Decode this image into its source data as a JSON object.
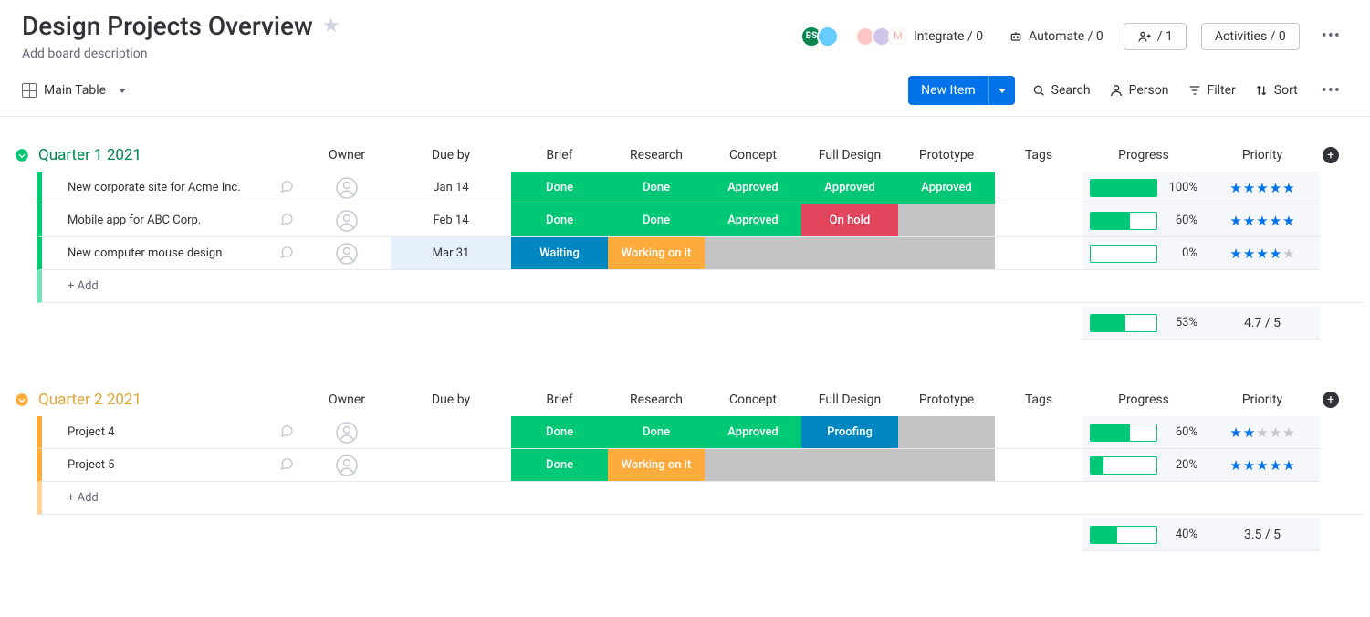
{
  "header": {
    "title": "Design Projects Overview",
    "description_placeholder": "Add board description",
    "avatars": [
      "BS",
      ""
    ],
    "integrate_label": "Integrate / 0",
    "automate_label": "Automate / 0",
    "invite_label": "/ 1",
    "activities_label": "Activities / 0"
  },
  "toolbar": {
    "view_label": "Main Table",
    "new_item_label": "New Item",
    "search_label": "Search",
    "person_label": "Person",
    "filter_label": "Filter",
    "sort_label": "Sort"
  },
  "columns": {
    "owner": "Owner",
    "due": "Due by",
    "brief": "Brief",
    "research": "Research",
    "concept": "Concept",
    "full_design": "Full Design",
    "prototype": "Prototype",
    "tags": "Tags",
    "progress": "Progress",
    "priority": "Priority"
  },
  "status_colors": {
    "Done": "#00c875",
    "Approved": "#00c875",
    "Waiting": "#0086c0",
    "Proofing": "#0086c0",
    "Working on it": "#fdab3d",
    "On hold": "#e2445c",
    "": "#c4c4c4"
  },
  "add_row_label": "+ Add",
  "groups": [
    {
      "name": "Quarter 1 2021",
      "color": "#00c875",
      "text_color": "#00854d",
      "summary": {
        "progress": 53,
        "priority": "4.7 / 5"
      },
      "items": [
        {
          "name": "New corporate site for Acme Inc.",
          "due": "Jan 14",
          "due_hl": false,
          "status": [
            "Done",
            "Done",
            "Approved",
            "Approved",
            "Approved"
          ],
          "progress": 100,
          "stars": 5
        },
        {
          "name": "Mobile app for ABC Corp.",
          "due": "Feb 14",
          "due_hl": false,
          "status": [
            "Done",
            "Done",
            "Approved",
            "On hold",
            ""
          ],
          "progress": 60,
          "stars": 5
        },
        {
          "name": "New computer mouse design",
          "due": "Mar 31",
          "due_hl": true,
          "status": [
            "Waiting",
            "Working on it",
            "",
            "",
            ""
          ],
          "progress": 0,
          "stars": 4
        }
      ]
    },
    {
      "name": "Quarter 2 2021",
      "color": "#fdab3d",
      "text_color": "#e2a33a",
      "summary": {
        "progress": 40,
        "priority": "3.5 / 5"
      },
      "items": [
        {
          "name": "Project 4",
          "due": "",
          "due_hl": false,
          "status": [
            "Done",
            "Done",
            "Approved",
            "Proofing",
            ""
          ],
          "progress": 60,
          "stars": 2
        },
        {
          "name": "Project 5",
          "due": "",
          "due_hl": false,
          "status": [
            "Done",
            "Working on it",
            "",
            "",
            ""
          ],
          "progress": 20,
          "stars": 5
        }
      ]
    }
  ]
}
